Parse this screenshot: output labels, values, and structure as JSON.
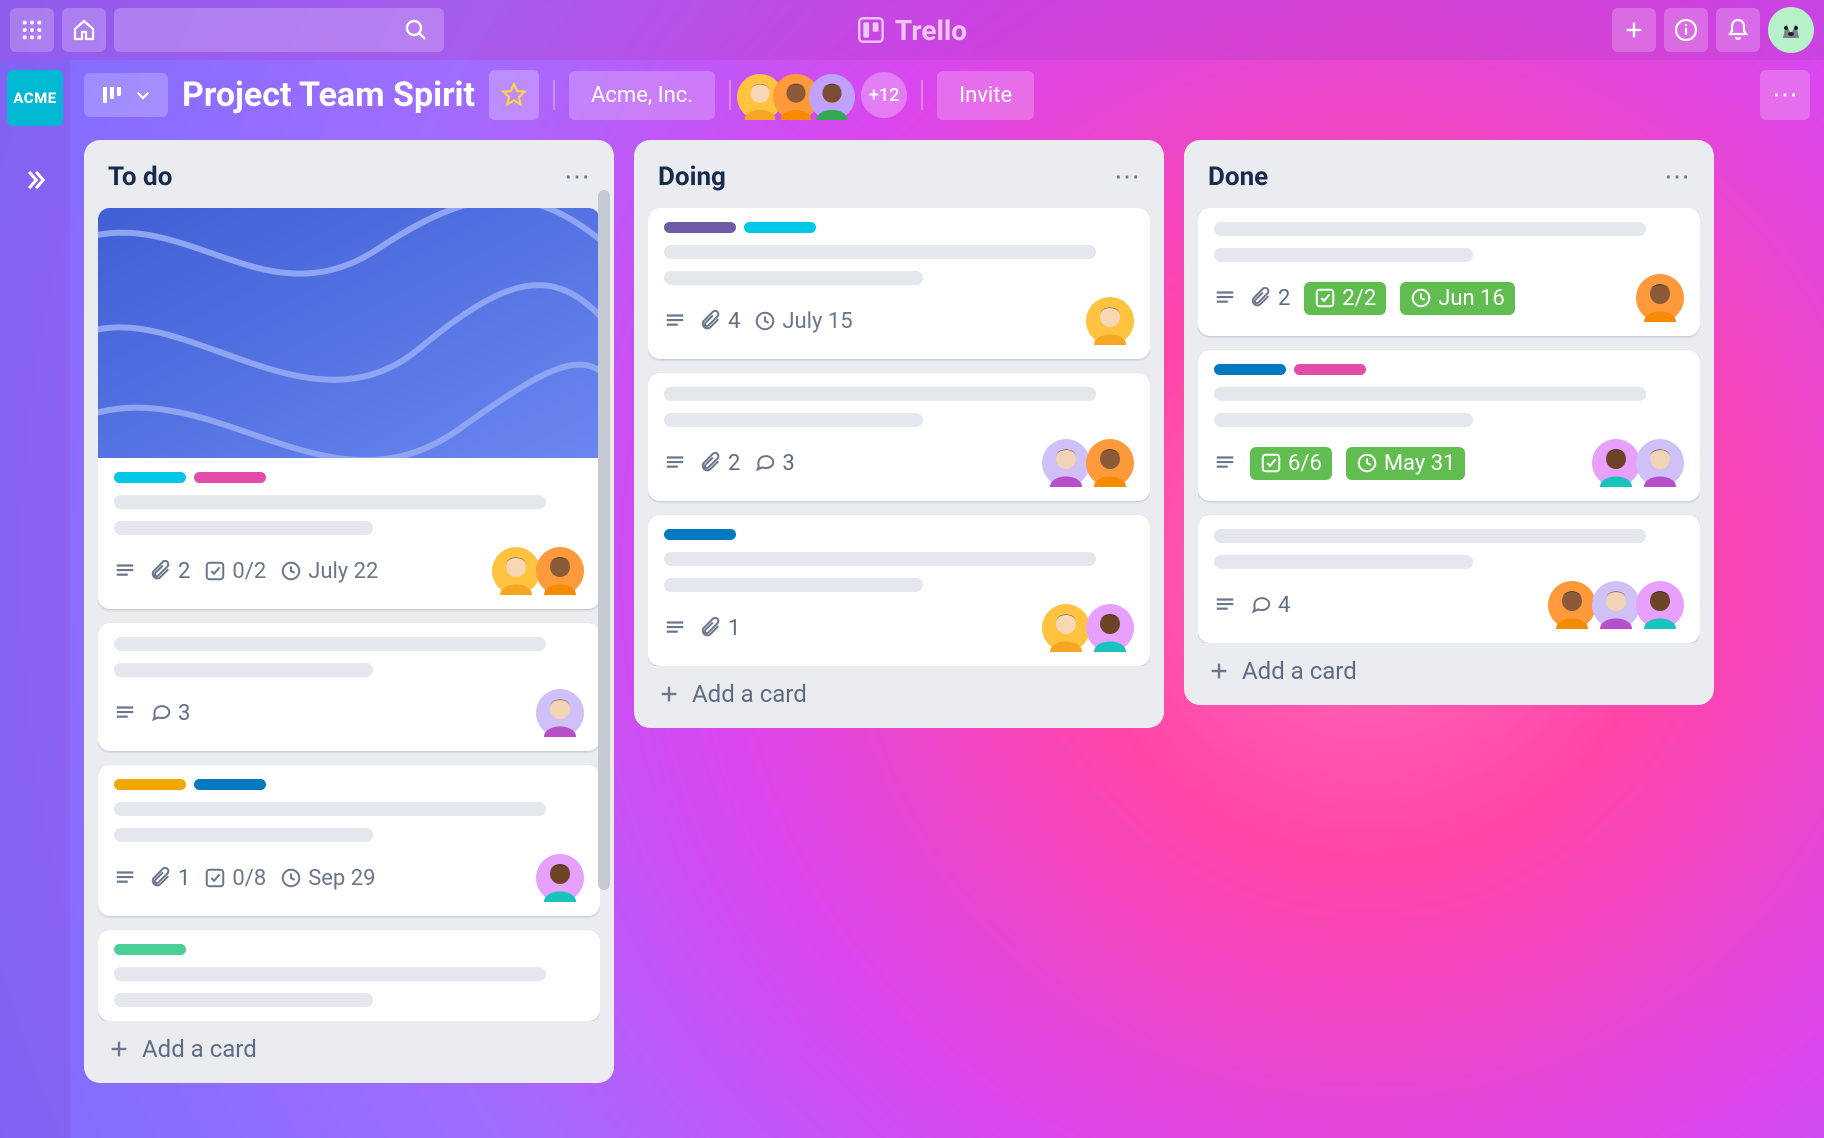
{
  "app": {
    "name": "Trello"
  },
  "board": {
    "title": "Project Team Spirit",
    "workspace_tag": "ACME",
    "org_name": "Acme, Inc.",
    "more_members": "+12",
    "invite_label": "Invite"
  },
  "header_avatars": [
    "user-a",
    "user-b",
    "user-c"
  ],
  "lists": [
    {
      "title": "To do",
      "add_label": "Add a card",
      "cards": [
        {
          "cover": true,
          "labels": [
            "#00c7e5",
            "#e34ba9"
          ],
          "badges": {
            "desc": true,
            "attach": "2",
            "check": "0/2",
            "due": "July 22",
            "check_done": false
          },
          "members": [
            "user-a",
            "user-b"
          ]
        },
        {
          "labels": [],
          "badges": {
            "desc": true,
            "comments": "3"
          },
          "members": [
            "user-d"
          ]
        },
        {
          "labels": [
            "#f2a600",
            "#0079bf"
          ],
          "badges": {
            "desc": true,
            "attach": "1",
            "check": "0/8",
            "due": "Sep 29",
            "check_done": false
          },
          "members": [
            "user-e"
          ]
        },
        {
          "labels": [
            "#4bce97"
          ],
          "badges": {},
          "members": []
        }
      ]
    },
    {
      "title": "Doing",
      "add_label": "Add a card",
      "cards": [
        {
          "labels": [
            "#6b5ca5",
            "#00c7e5"
          ],
          "badges": {
            "desc": true,
            "attach": "4",
            "due": "July 15"
          },
          "members": [
            "user-a"
          ]
        },
        {
          "labels": [],
          "badges": {
            "desc": true,
            "comments": "3",
            "attach": "2"
          },
          "members": [
            "user-d",
            "user-b"
          ]
        },
        {
          "labels": [
            "#0079bf"
          ],
          "badges": {
            "desc": true,
            "attach": "1"
          },
          "members": [
            "user-a",
            "user-e"
          ]
        }
      ]
    },
    {
      "title": "Done",
      "add_label": "Add a card",
      "cards": [
        {
          "labels": [],
          "badges": {
            "desc": true,
            "attach": "2",
            "check": "2/2",
            "check_done": true,
            "due": "Jun 16",
            "due_done": true
          },
          "members": [
            "user-b"
          ]
        },
        {
          "labels": [
            "#0079bf",
            "#e34ba9"
          ],
          "badges": {
            "desc": true,
            "check": "6/6",
            "check_done": true,
            "due": "May 31",
            "due_done": true
          },
          "members": [
            "user-e",
            "user-d"
          ]
        },
        {
          "labels": [],
          "badges": {
            "desc": true,
            "comments": "4"
          },
          "members": [
            "user-b",
            "user-d",
            "user-e"
          ]
        }
      ]
    }
  ],
  "avatar_defs": {
    "user-a": {
      "bg": "#ffc340",
      "body": "#f6a623",
      "skin": "#f8d7b5",
      "hair": "#2b2b2b"
    },
    "user-b": {
      "bg": "#ff9a3c",
      "body": "#f68a00",
      "skin": "#8a5a39",
      "hair": "#1f1f1f"
    },
    "user-c": {
      "bg": "#bfa2ff",
      "body": "#32a852",
      "skin": "#7a4d32",
      "hair": "#111"
    },
    "user-d": {
      "bg": "#cfc1f7",
      "body": "#b74fc9",
      "skin": "#f1d3b5",
      "hair": "#222"
    },
    "user-e": {
      "bg": "#e8a0ff",
      "body": "#18c2bd",
      "skin": "#6e4429",
      "hair": "#111"
    }
  }
}
